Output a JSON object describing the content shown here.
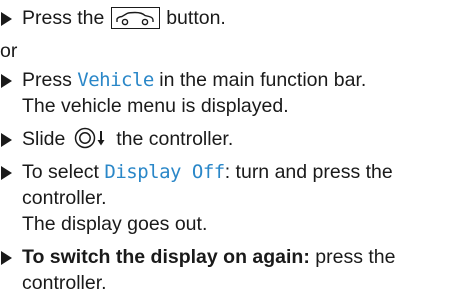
{
  "steps": {
    "s1": {
      "before": "Press the",
      "icon": "car-button-icon",
      "after": " button."
    },
    "or": "or",
    "s2": {
      "before": "Press ",
      "term": "Vehicle",
      "after": " in the main function bar.",
      "result": "The vehicle menu is displayed."
    },
    "s3": {
      "before": "Slide ",
      "icon": "controller-slide-down-icon",
      "after": " the controller."
    },
    "s4": {
      "before": "To select ",
      "term": "Display Off",
      "after": ": turn and press the",
      "line2": "controller.",
      "result": "The display goes out."
    },
    "s5": {
      "bold": "To switch the display on again:",
      "after": " press the",
      "line2": "controller."
    }
  },
  "colors": {
    "text": "#1a1a1a",
    "ui_term": "#2a87c8"
  }
}
